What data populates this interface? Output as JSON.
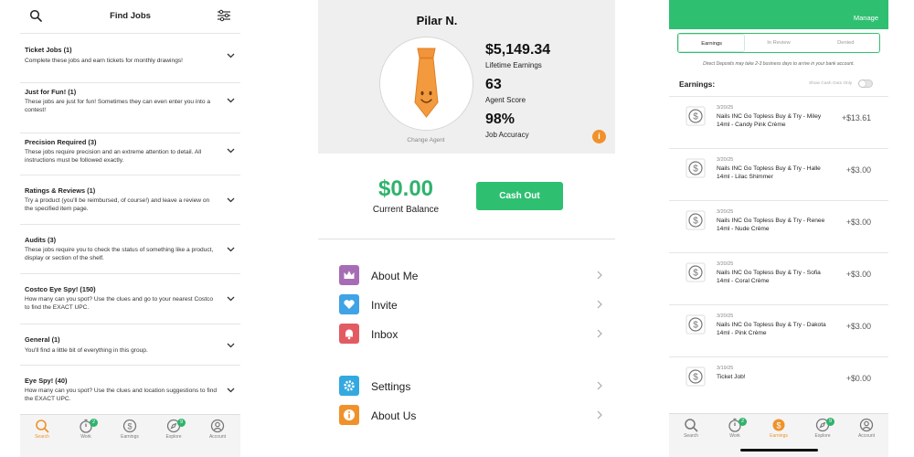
{
  "find_jobs": {
    "title": "Find Jobs",
    "jobs": [
      {
        "title": "Ticket Jobs (1)",
        "desc": "Complete these jobs and earn tickets for monthly drawings!"
      },
      {
        "title": "Just for Fun! (1)",
        "desc": "These jobs are just for fun! Sometimes they can even enter you into a contest!"
      },
      {
        "title": "Precision Required (3)",
        "desc": "These jobs require precision and an extreme attention to detail. All instructions must be followed exactly."
      },
      {
        "title": "Ratings & Reviews (1)",
        "desc": "Try a product (you'll be reimbursed, of course!) and leave a review on the specified item page."
      },
      {
        "title": "Audits (3)",
        "desc": "These jobs require you to check the status of something like a product, display or section of the shelf."
      },
      {
        "title": "Costco Eye Spy! (150)",
        "desc": "How many can you spot? Use the clues and go to your nearest Costco to find the EXACT UPC."
      },
      {
        "title": "General (1)",
        "desc": "You'll find a little bit of everything in this group."
      },
      {
        "title": "Eye Spy! (40)",
        "desc": "How many can you spot? Use the clues and location suggestions to find the EXACT UPC."
      }
    ]
  },
  "tabs": [
    {
      "label": "Search",
      "icon": "search-icon"
    },
    {
      "label": "Work",
      "icon": "stopwatch-icon",
      "badge": "2"
    },
    {
      "label": "Earnings",
      "icon": "dollar-icon"
    },
    {
      "label": "Explore",
      "icon": "compass-icon",
      "badge": "9"
    },
    {
      "label": "Account",
      "icon": "account-icon"
    }
  ],
  "profile": {
    "name": "Pilar N.",
    "change_agent": "Change Agent",
    "lifetime_earnings_value": "$5,149.34",
    "lifetime_earnings_label": "Lifetime Earnings",
    "agent_score_value": "63",
    "agent_score_label": "Agent Score",
    "job_accuracy_value": "98%",
    "job_accuracy_label": "Job Accuracy",
    "info": "i",
    "balance": "$0.00",
    "balance_label": "Current Balance",
    "cash_out": "Cash Out",
    "menu": [
      {
        "label": "About Me",
        "icon": "crown-icon",
        "color": "#a66db5"
      },
      {
        "label": "Invite",
        "icon": "heart-icon",
        "color": "#3fa3e6"
      },
      {
        "label": "Inbox",
        "icon": "bell-icon",
        "color": "#e35b62"
      },
      {
        "label": "Settings",
        "icon": "gear-icon",
        "color": "#33a9e0"
      },
      {
        "label": "About Us",
        "icon": "info-icon",
        "color": "#f0922b"
      }
    ]
  },
  "earnings": {
    "manage": "Manage",
    "segments": [
      "Earnings",
      "In Review",
      "Denied"
    ],
    "notice": "Direct Deposits may take 2-3 business days to arrive in your bank account.",
    "heading": "Earnings:",
    "show_cash_outs": "Show Cash Outs Only",
    "rows": [
      {
        "date": "3/20/25",
        "desc": "Nails INC Go Topless Buy & Try - Miley 14ml - Candy Pink Crème",
        "amount": "+$13.61"
      },
      {
        "date": "3/20/25",
        "desc": "Nails INC Go Topless Buy & Try - Halle 14ml - Lilac Shimmer",
        "amount": "+$3.00"
      },
      {
        "date": "3/20/25",
        "desc": "Nails INC Go Topless Buy & Try - Renee 14ml - Nude Crème",
        "amount": "+$3.00"
      },
      {
        "date": "3/20/25",
        "desc": "Nails INC Go Topless Buy & Try - Sofia 14ml - Coral Crème",
        "amount": "+$3.00"
      },
      {
        "date": "3/20/25",
        "desc": "Nails INC Go Topless Buy & Try - Dakota 14ml - Pink Crème",
        "amount": "+$3.00"
      },
      {
        "date": "3/19/25",
        "desc": "Ticket Job!",
        "amount": "+$0.00"
      }
    ]
  },
  "colors": {
    "green": "#2fbf71",
    "orange": "#f0922b"
  }
}
